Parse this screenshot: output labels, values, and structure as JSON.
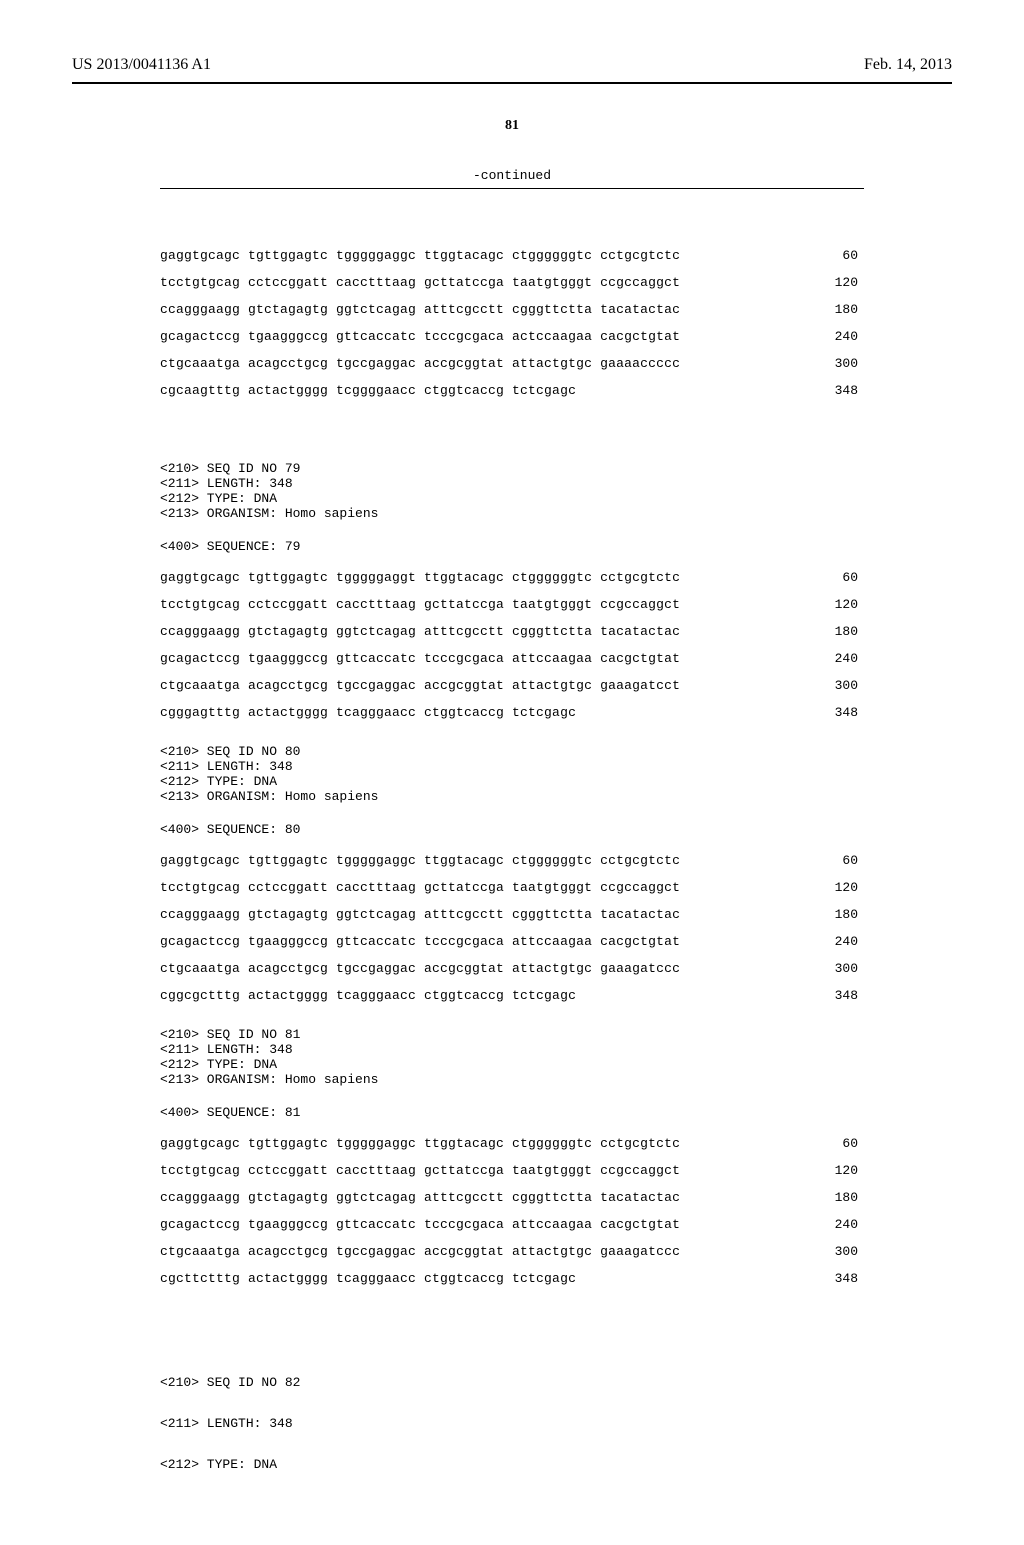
{
  "header": {
    "publication_number": "US 2013/0041136 A1",
    "publication_date": "Feb. 14, 2013"
  },
  "page_number": "81",
  "continued_label": "-continued",
  "initial_sequence": {
    "rows": [
      {
        "seq": "gaggtgcagc tgttggagtc tgggggaggc ttggtacagc ctggggggtc cctgcgtctc",
        "pos": "60"
      },
      {
        "seq": "tcctgtgcag cctccggatt cacctttaag gcttatccga taatgtgggt ccgccaggct",
        "pos": "120"
      },
      {
        "seq": "ccagggaagg gtctagagtg ggtctcagag atttcgcctt cgggttctta tacatactac",
        "pos": "180"
      },
      {
        "seq": "gcagactccg tgaagggccg gttcaccatc tcccgcgaca actccaagaa cacgctgtat",
        "pos": "240"
      },
      {
        "seq": "ctgcaaatga acagcctgcg tgccgaggac accgcggtat attactgtgc gaaaaccccc",
        "pos": "300"
      },
      {
        "seq": "cgcaagtttg actactgggg tcggggaacc ctggtcaccg tctcgagc",
        "pos": "348"
      }
    ]
  },
  "entries": [
    {
      "meta": {
        "seq_id": "<210> SEQ ID NO 79",
        "length": "<211> LENGTH: 348",
        "type": "<212> TYPE: DNA",
        "organism": "<213> ORGANISM: Homo sapiens"
      },
      "sequence_header": "<400> SEQUENCE: 79",
      "rows": [
        {
          "seq": "gaggtgcagc tgttggagtc tgggggaggt ttggtacagc ctggggggtc cctgcgtctc",
          "pos": "60"
        },
        {
          "seq": "tcctgtgcag cctccggatt cacctttaag gcttatccga taatgtgggt ccgccaggct",
          "pos": "120"
        },
        {
          "seq": "ccagggaagg gtctagagtg ggtctcagag atttcgcctt cgggttctta tacatactac",
          "pos": "180"
        },
        {
          "seq": "gcagactccg tgaagggccg gttcaccatc tcccgcgaca attccaagaa cacgctgtat",
          "pos": "240"
        },
        {
          "seq": "ctgcaaatga acagcctgcg tgccgaggac accgcggtat attactgtgc gaaagatcct",
          "pos": "300"
        },
        {
          "seq": "cgggagtttg actactgggg tcagggaacc ctggtcaccg tctcgagc",
          "pos": "348"
        }
      ]
    },
    {
      "meta": {
        "seq_id": "<210> SEQ ID NO 80",
        "length": "<211> LENGTH: 348",
        "type": "<212> TYPE: DNA",
        "organism": "<213> ORGANISM: Homo sapiens"
      },
      "sequence_header": "<400> SEQUENCE: 80",
      "rows": [
        {
          "seq": "gaggtgcagc tgttggagtc tgggggaggc ttggtacagc ctggggggtc cctgcgtctc",
          "pos": "60"
        },
        {
          "seq": "tcctgtgcag cctccggatt cacctttaag gcttatccga taatgtgggt ccgccaggct",
          "pos": "120"
        },
        {
          "seq": "ccagggaagg gtctagagtg ggtctcagag atttcgcctt cgggttctta tacatactac",
          "pos": "180"
        },
        {
          "seq": "gcagactccg tgaagggccg gttcaccatc tcccgcgaca attccaagaa cacgctgtat",
          "pos": "240"
        },
        {
          "seq": "ctgcaaatga acagcctgcg tgccgaggac accgcggtat attactgtgc gaaagatccc",
          "pos": "300"
        },
        {
          "seq": "cggcgctttg actactgggg tcagggaacc ctggtcaccg tctcgagc",
          "pos": "348"
        }
      ]
    },
    {
      "meta": {
        "seq_id": "<210> SEQ ID NO 81",
        "length": "<211> LENGTH: 348",
        "type": "<212> TYPE: DNA",
        "organism": "<213> ORGANISM: Homo sapiens"
      },
      "sequence_header": "<400> SEQUENCE: 81",
      "rows": [
        {
          "seq": "gaggtgcagc tgttggagtc tgggggaggc ttggtacagc ctggggggtc cctgcgtctc",
          "pos": "60"
        },
        {
          "seq": "tcctgtgcag cctccggatt cacctttaag gcttatccga taatgtgggt ccgccaggct",
          "pos": "120"
        },
        {
          "seq": "ccagggaagg gtctagagtg ggtctcagag atttcgcctt cgggttctta tacatactac",
          "pos": "180"
        },
        {
          "seq": "gcagactccg tgaagggccg gttcaccatc tcccgcgaca attccaagaa cacgctgtat",
          "pos": "240"
        },
        {
          "seq": "ctgcaaatga acagcctgcg tgccgaggac accgcggtat attactgtgc gaaagatccc",
          "pos": "300"
        },
        {
          "seq": "cgcttctttg actactgggg tcagggaacc ctggtcaccg tctcgagc",
          "pos": "348"
        }
      ]
    }
  ],
  "trailing_meta": {
    "seq_id": "<210> SEQ ID NO 82",
    "length": "<211> LENGTH: 348",
    "type": "<212> TYPE: DNA"
  }
}
